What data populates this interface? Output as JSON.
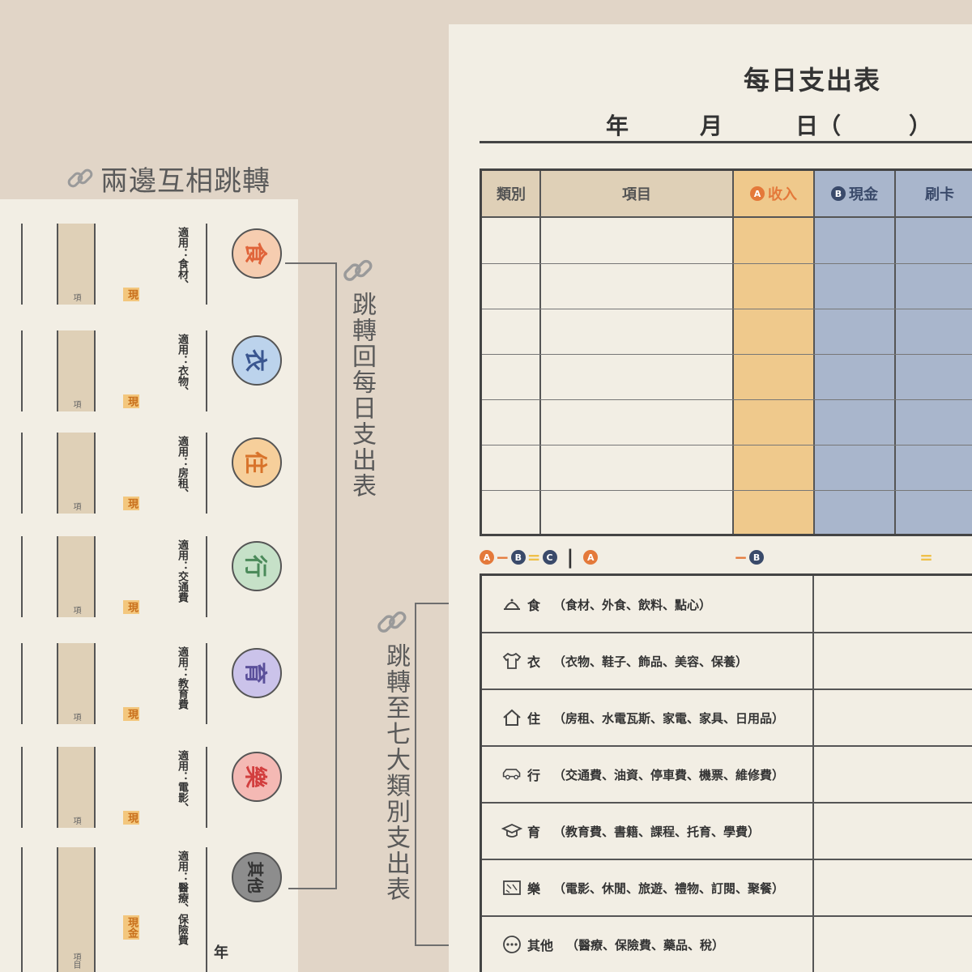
{
  "caption_left": "兩邊互相跳轉",
  "label_back": "跳轉回每日支出表",
  "label_to_categories": "跳轉至七大類別支出表",
  "left_sheet": {
    "item_label": "項",
    "item_label_full": "項目",
    "cash_label": "現",
    "cash_label_full": "現金",
    "year_label": "年",
    "rows": [
      {
        "char": "食",
        "apply": "適用：食材、",
        "color": "#e0643a",
        "fill": "#f6cdb0"
      },
      {
        "char": "衣",
        "apply": "適用：衣物、",
        "color": "#3a5690",
        "fill": "#bcd3ec"
      },
      {
        "char": "住",
        "apply": "適用：房租、",
        "color": "#d8732a",
        "fill": "#f6cf9b"
      },
      {
        "char": "行",
        "apply": "適用：交通費",
        "color": "#4b8a5a",
        "fill": "#c6e1c8"
      },
      {
        "char": "育",
        "apply": "適用：教育費",
        "color": "#5a4f9a",
        "fill": "#cbc3ea"
      },
      {
        "char": "樂",
        "apply": "適用：電影、",
        "color": "#d23e3e",
        "fill": "#f4b9b4"
      },
      {
        "char": "其他",
        "apply": "適用：醫療、保險費",
        "color": "#333333",
        "fill": "#8d8d8d"
      }
    ]
  },
  "right_sheet": {
    "title": "每日支出表",
    "date": {
      "year": "年",
      "month": "月",
      "day": "日（",
      "close": "）"
    },
    "headers": {
      "category": "類別",
      "item": "項目",
      "income_badge": "A",
      "income": "收入",
      "cash_badge": "B",
      "cash": "現金",
      "card": "刷卡"
    },
    "formula": {
      "a": "A",
      "b": "B",
      "c": "C",
      "minus": "−",
      "equals": "=",
      "sep": "|"
    },
    "categories": [
      {
        "icon": "cloche-icon",
        "name": "食",
        "detail": "（食材、外食、飲料、點心）"
      },
      {
        "icon": "tshirt-icon",
        "name": "衣",
        "detail": "（衣物、鞋子、飾品、美容、保養）"
      },
      {
        "icon": "house-icon",
        "name": "住",
        "detail": "（房租、水電瓦斯、家電、家具、日用品）"
      },
      {
        "icon": "car-icon",
        "name": "行",
        "detail": "（交通費、油資、停車費、機票、維修費）"
      },
      {
        "icon": "mortarboard-icon",
        "name": "育",
        "detail": "（教育費、書籍、課程、托育、學費）"
      },
      {
        "icon": "ticket-icon",
        "name": "樂",
        "detail": "（電影、休閒、旅遊、禮物、訂閱、聚餐）"
      },
      {
        "icon": "more-icon",
        "name": "其他",
        "detail": "（醫療、保險費、藥品、稅）"
      }
    ]
  },
  "colors": {
    "background": "#e1d5c7",
    "paper": "#f2eee4",
    "income_col": "#efc98c",
    "cash_col": "#a9b6cc",
    "header_tan": "#dfd0b7",
    "accent_orange": "#e4793a",
    "accent_navy": "#3a4a6a"
  }
}
